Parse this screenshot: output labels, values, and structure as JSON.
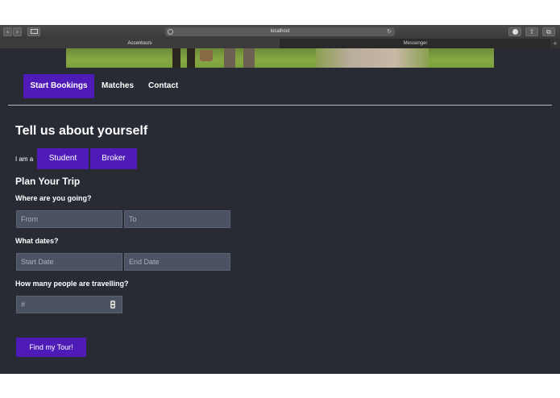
{
  "browser": {
    "url": "localhost",
    "tabs": [
      {
        "label": "Accentours",
        "active": true
      },
      {
        "label": "Messenger",
        "active": false
      }
    ],
    "new_tab": "+",
    "back": "‹",
    "forward": "›"
  },
  "nav": {
    "items": [
      {
        "label": "Start Bookings",
        "active": true
      },
      {
        "label": "Matches",
        "active": false
      },
      {
        "label": "Contact",
        "active": false
      }
    ]
  },
  "form": {
    "title": "Tell us about yourself",
    "iam_label": "I am a",
    "role_options": [
      "Student",
      "Broker"
    ],
    "plan_title": "Plan Your Trip",
    "where_question": "Where are you going?",
    "from_placeholder": "From",
    "to_placeholder": "To",
    "dates_question": "What dates?",
    "start_placeholder": "Start Date",
    "end_placeholder": "End Date",
    "people_question": "How many people are travelling?",
    "people_placeholder": "#",
    "submit_label": "Find my Tour!"
  },
  "colors": {
    "accent": "#4f1bb8",
    "background": "#282a34",
    "field": "#4b5261"
  }
}
